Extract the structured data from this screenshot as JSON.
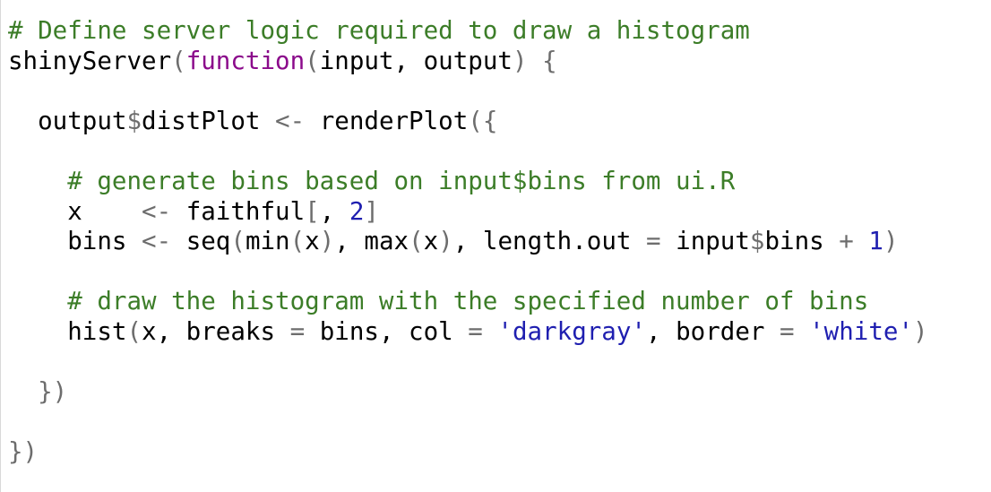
{
  "editor": {
    "language": "R",
    "colors": {
      "background": "#ffffff",
      "comment": "#3c7d28",
      "plain": "#000000",
      "keyword": "#8b0a8b",
      "paren": "#6d6d6d",
      "operator": "#6d6d6d",
      "number": "#1f1fb0",
      "string": "#1f1fb0"
    },
    "lines": [
      [
        {
          "t": "comment",
          "v": "# Define server logic required to draw a histogram"
        }
      ],
      [
        {
          "t": "plain",
          "v": "shinyServer"
        },
        {
          "t": "paren",
          "v": "("
        },
        {
          "t": "keyword",
          "v": "function"
        },
        {
          "t": "paren",
          "v": "("
        },
        {
          "t": "plain",
          "v": "input, output"
        },
        {
          "t": "paren",
          "v": ")"
        },
        {
          "t": "plain",
          "v": " "
        },
        {
          "t": "paren",
          "v": "{"
        }
      ],
      [],
      [
        {
          "t": "plain",
          "v": "  output"
        },
        {
          "t": "op",
          "v": "$"
        },
        {
          "t": "plain",
          "v": "distPlot "
        },
        {
          "t": "op",
          "v": "<-"
        },
        {
          "t": "plain",
          "v": " renderPlot"
        },
        {
          "t": "paren",
          "v": "({"
        }
      ],
      [],
      [
        {
          "t": "comment",
          "v": "    # generate bins based on input$bins from ui.R"
        }
      ],
      [
        {
          "t": "plain",
          "v": "    x    "
        },
        {
          "t": "op",
          "v": "<-"
        },
        {
          "t": "plain",
          "v": " faithful"
        },
        {
          "t": "paren",
          "v": "["
        },
        {
          "t": "plain",
          "v": ", "
        },
        {
          "t": "number",
          "v": "2"
        },
        {
          "t": "paren",
          "v": "]"
        }
      ],
      [
        {
          "t": "plain",
          "v": "    bins "
        },
        {
          "t": "op",
          "v": "<-"
        },
        {
          "t": "plain",
          "v": " seq"
        },
        {
          "t": "paren",
          "v": "("
        },
        {
          "t": "plain",
          "v": "min"
        },
        {
          "t": "paren",
          "v": "("
        },
        {
          "t": "plain",
          "v": "x"
        },
        {
          "t": "paren",
          "v": ")"
        },
        {
          "t": "plain",
          "v": ", max"
        },
        {
          "t": "paren",
          "v": "("
        },
        {
          "t": "plain",
          "v": "x"
        },
        {
          "t": "paren",
          "v": ")"
        },
        {
          "t": "plain",
          "v": ", length.out "
        },
        {
          "t": "op",
          "v": "="
        },
        {
          "t": "plain",
          "v": " input"
        },
        {
          "t": "op",
          "v": "$"
        },
        {
          "t": "plain",
          "v": "bins "
        },
        {
          "t": "op",
          "v": "+"
        },
        {
          "t": "plain",
          "v": " "
        },
        {
          "t": "number",
          "v": "1"
        },
        {
          "t": "paren",
          "v": ")"
        }
      ],
      [],
      [
        {
          "t": "comment",
          "v": "    # draw the histogram with the specified number of bins"
        }
      ],
      [
        {
          "t": "plain",
          "v": "    hist"
        },
        {
          "t": "paren",
          "v": "("
        },
        {
          "t": "plain",
          "v": "x, breaks "
        },
        {
          "t": "op",
          "v": "="
        },
        {
          "t": "plain",
          "v": " bins, col "
        },
        {
          "t": "op",
          "v": "="
        },
        {
          "t": "plain",
          "v": " "
        },
        {
          "t": "string",
          "v": "'darkgray'"
        },
        {
          "t": "plain",
          "v": ", border "
        },
        {
          "t": "op",
          "v": "="
        },
        {
          "t": "plain",
          "v": " "
        },
        {
          "t": "string",
          "v": "'white'"
        },
        {
          "t": "paren",
          "v": ")"
        }
      ],
      [],
      [
        {
          "t": "plain",
          "v": "  "
        },
        {
          "t": "paren",
          "v": "})"
        }
      ],
      [],
      [
        {
          "t": "paren",
          "v": "})"
        }
      ]
    ]
  }
}
